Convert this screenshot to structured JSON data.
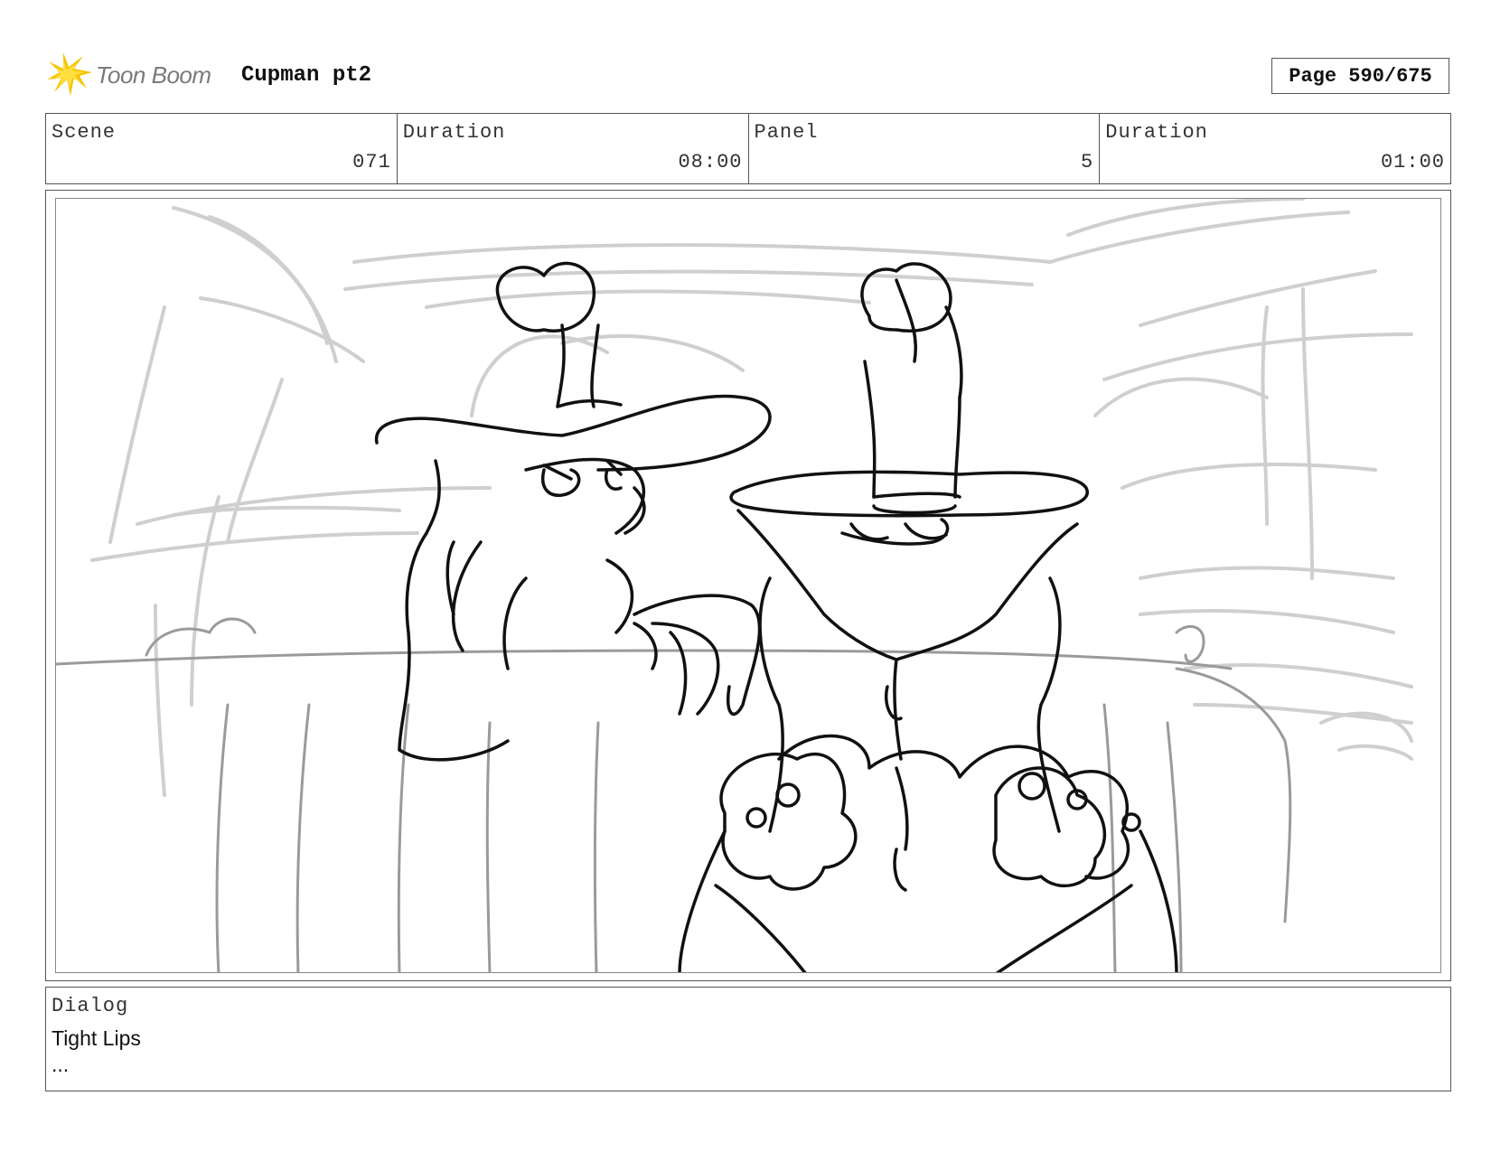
{
  "header": {
    "logo_text": "Toon Boom",
    "project_title": "Cupman pt2",
    "page_indicator": "Page 590/675"
  },
  "info": {
    "scene_label": "Scene",
    "scene_value": "071",
    "scene_duration_label": "Duration",
    "scene_duration_value": "08:00",
    "panel_label": "Panel",
    "panel_value": "5",
    "panel_duration_label": "Duration",
    "panel_duration_value": "01:00"
  },
  "panel": {
    "icon": "storyboard-sketch-image"
  },
  "dialog": {
    "label": "Dialog",
    "lines": [
      "Tight Lips",
      "..."
    ]
  },
  "colors": {
    "logo_accent": "#f5c400",
    "frame_border": "#555555",
    "sketch_line": "#111111",
    "background_sketch": "#cfcfcf"
  }
}
